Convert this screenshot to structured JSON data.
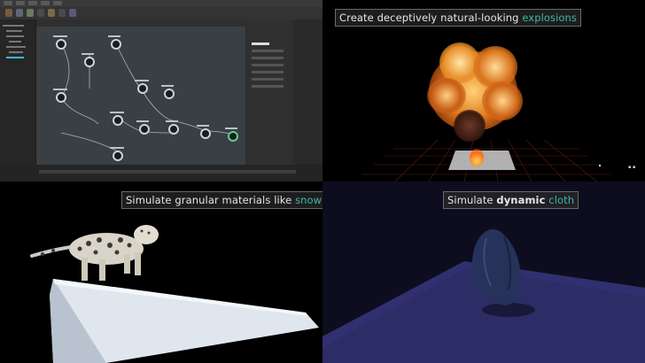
{
  "captions": {
    "explosions": {
      "prefix": "Create deceptively natural-looking ",
      "highlight": "explosions"
    },
    "snow": {
      "prefix": "Simulate granular materials like ",
      "highlight": "snow"
    },
    "cloth": {
      "prefix": "Simulate ",
      "bold": "dynamic",
      "middle": " ",
      "highlight": "cloth"
    }
  },
  "colors": {
    "highlight": "#3fb6a8",
    "caption_bg": "#282828",
    "ui_bg": "#2b2b2b",
    "network_bg": "#3a3f44",
    "cloth_bg": "#1a1a3a"
  },
  "icons": [
    "node-icon",
    "viewport-icon",
    "fireball-icon",
    "snow-leopard-icon",
    "cloth-icon"
  ]
}
